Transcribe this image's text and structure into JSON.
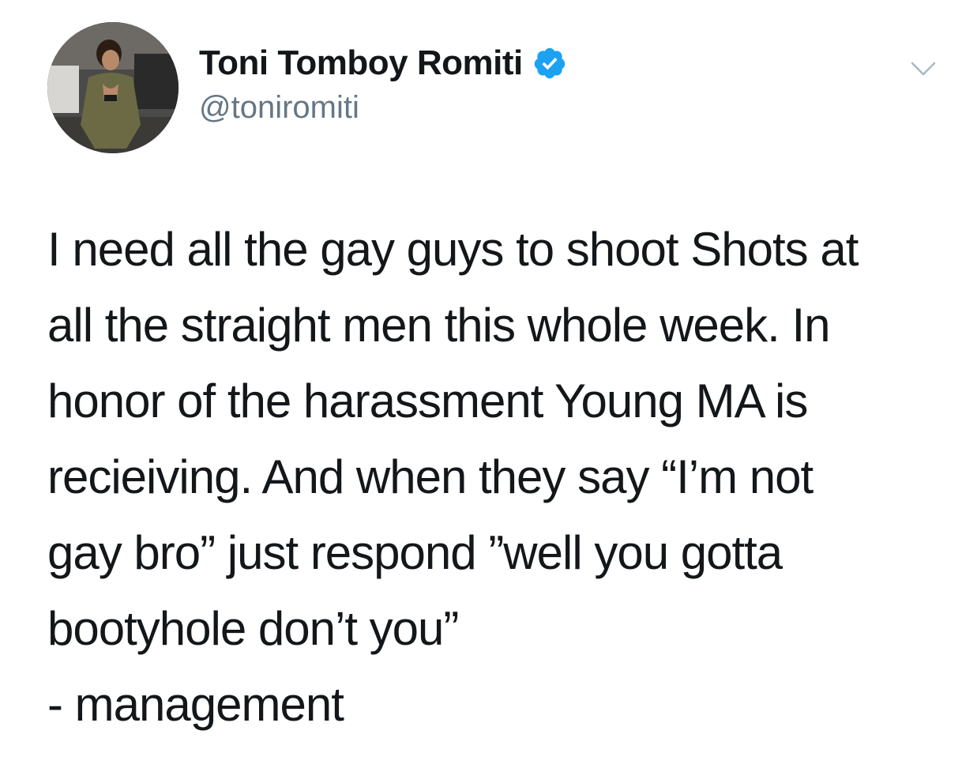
{
  "author": {
    "display_name": "Toni Tomboy Romiti",
    "handle": "@toniromiti",
    "verified": true,
    "verified_color": "#1da1f2"
  },
  "icons": {
    "verified": "verified-badge-icon",
    "menu": "chevron-down-icon"
  },
  "tweet": {
    "lines": [
      "I need all the gay guys to shoot Shots at",
      "all the straight men this whole week.  In",
      "honor of the harassment Young MA is",
      "recieiving. And when they say “I’m not",
      "gay bro” just respond ”well you gotta",
      "bootyhole don’t you”",
      "- management"
    ]
  },
  "colors": {
    "text": "#14171a",
    "secondary": "#657786",
    "chevron": "#aab8c2"
  }
}
